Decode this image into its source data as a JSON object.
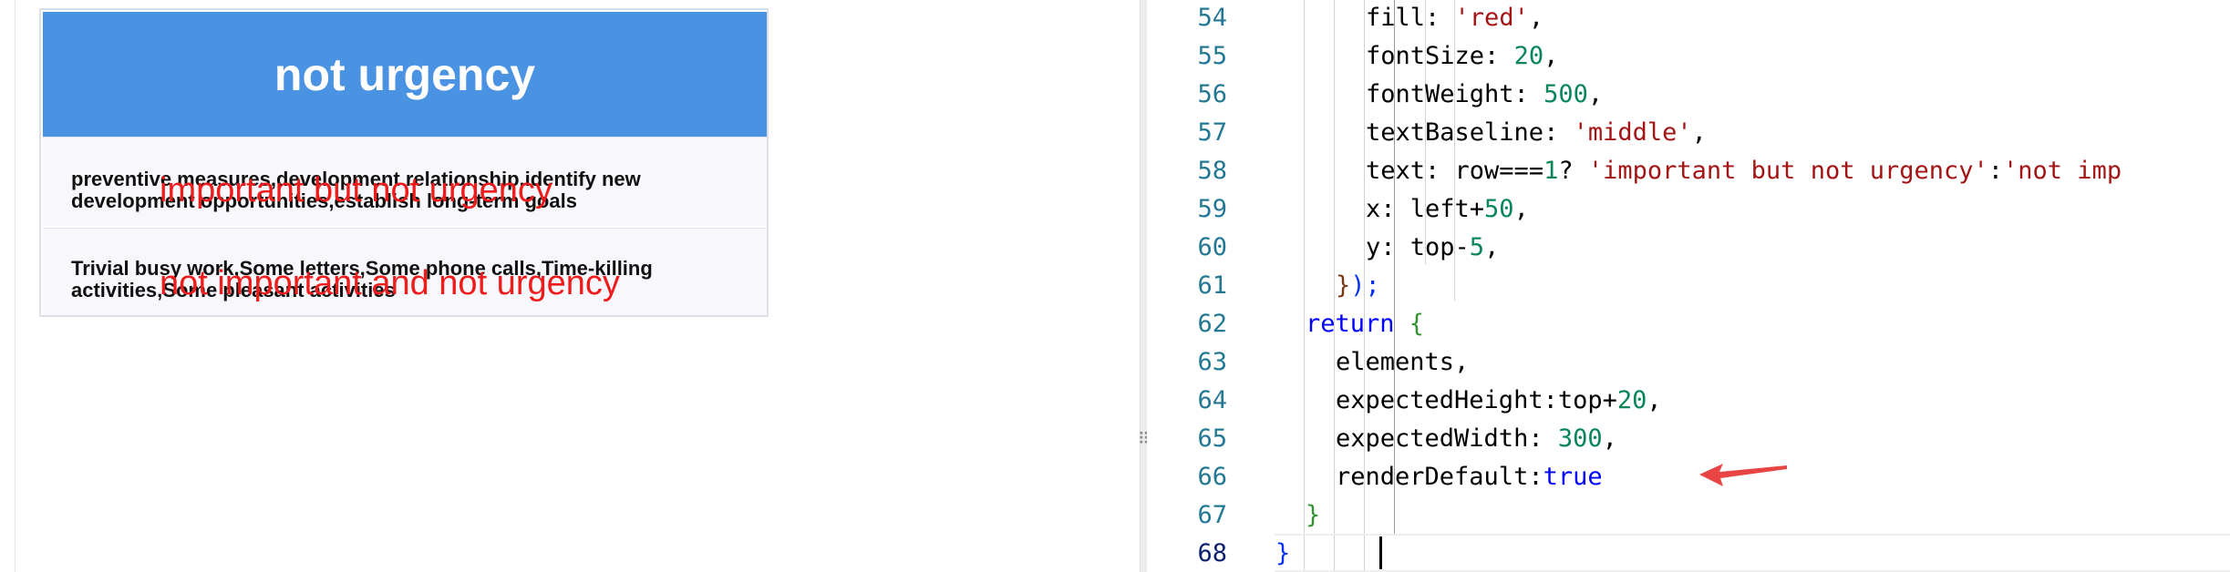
{
  "preview": {
    "header_title": "not urgency",
    "rows": [
      {
        "cell_text": "preventive measures,development relationship,identify new development opportunities,establish long-term goals",
        "overlay_text": "important but not urgency"
      },
      {
        "cell_text": "Trivial busy work,Some letters,Some phone calls,Time-killing activities,Some pleasant activities",
        "overlay_text": "not important and not urgency"
      }
    ],
    "header_color": "#4a93e3",
    "overlay_color": "#ef1c1c"
  },
  "divider": {
    "handle_glyph": "⠿"
  },
  "editor": {
    "lines": [
      {
        "number": "54",
        "indent": "      ",
        "tokens": [
          {
            "t": "fill: ",
            "c": "key"
          },
          {
            "t": "'red'",
            "c": "str"
          },
          {
            "t": ",",
            "c": "key"
          }
        ]
      },
      {
        "number": "55",
        "indent": "      ",
        "tokens": [
          {
            "t": "fontSize: ",
            "c": "key"
          },
          {
            "t": "20",
            "c": "num"
          },
          {
            "t": ",",
            "c": "key"
          }
        ]
      },
      {
        "number": "56",
        "indent": "      ",
        "tokens": [
          {
            "t": "fontWeight: ",
            "c": "key"
          },
          {
            "t": "500",
            "c": "num"
          },
          {
            "t": ",",
            "c": "key"
          }
        ]
      },
      {
        "number": "57",
        "indent": "      ",
        "tokens": [
          {
            "t": "textBaseline: ",
            "c": "key"
          },
          {
            "t": "'middle'",
            "c": "str"
          },
          {
            "t": ",",
            "c": "key"
          }
        ]
      },
      {
        "number": "58",
        "indent": "      ",
        "tokens": [
          {
            "t": "text: row===",
            "c": "key"
          },
          {
            "t": "1",
            "c": "num"
          },
          {
            "t": "? ",
            "c": "key"
          },
          {
            "t": "'important but not urgency'",
            "c": "str"
          },
          {
            "t": ":",
            "c": "key"
          },
          {
            "t": "'not imp",
            "c": "str"
          }
        ]
      },
      {
        "number": "59",
        "indent": "      ",
        "tokens": [
          {
            "t": "x: left+",
            "c": "key"
          },
          {
            "t": "50",
            "c": "num"
          },
          {
            "t": ",",
            "c": "key"
          }
        ]
      },
      {
        "number": "60",
        "indent": "      ",
        "tokens": [
          {
            "t": "y: top-",
            "c": "key"
          },
          {
            "t": "5",
            "c": "num"
          },
          {
            "t": ",",
            "c": "key"
          }
        ]
      },
      {
        "number": "61",
        "indent": "    ",
        "tokens": [
          {
            "t": "}",
            "c": "br2"
          },
          {
            "t": ");",
            "c": "br3"
          }
        ]
      },
      {
        "number": "62",
        "indent": "  ",
        "tokens": [
          {
            "t": "return ",
            "c": "kw"
          },
          {
            "t": "{",
            "c": "br"
          }
        ]
      },
      {
        "number": "63",
        "indent": "    ",
        "tokens": [
          {
            "t": "elements,",
            "c": "key"
          }
        ]
      },
      {
        "number": "64",
        "indent": "    ",
        "tokens": [
          {
            "t": "expectedHeight:top+",
            "c": "key"
          },
          {
            "t": "20",
            "c": "num"
          },
          {
            "t": ",",
            "c": "key"
          }
        ]
      },
      {
        "number": "65",
        "indent": "    ",
        "tokens": [
          {
            "t": "expectedWidth: ",
            "c": "key"
          },
          {
            "t": "300",
            "c": "num"
          },
          {
            "t": ",",
            "c": "key"
          }
        ]
      },
      {
        "number": "66",
        "indent": "    ",
        "tokens": [
          {
            "t": "renderDefault:",
            "c": "key"
          },
          {
            "t": "true",
            "c": "kw"
          }
        ]
      },
      {
        "number": "67",
        "indent": "  ",
        "tokens": [
          {
            "t": "}",
            "c": "br"
          }
        ]
      },
      {
        "number": "68",
        "indent": "",
        "tokens": [
          {
            "t": "}",
            "c": "br3"
          }
        ]
      }
    ],
    "active_line": "68",
    "annotation_color": "#e84444"
  }
}
